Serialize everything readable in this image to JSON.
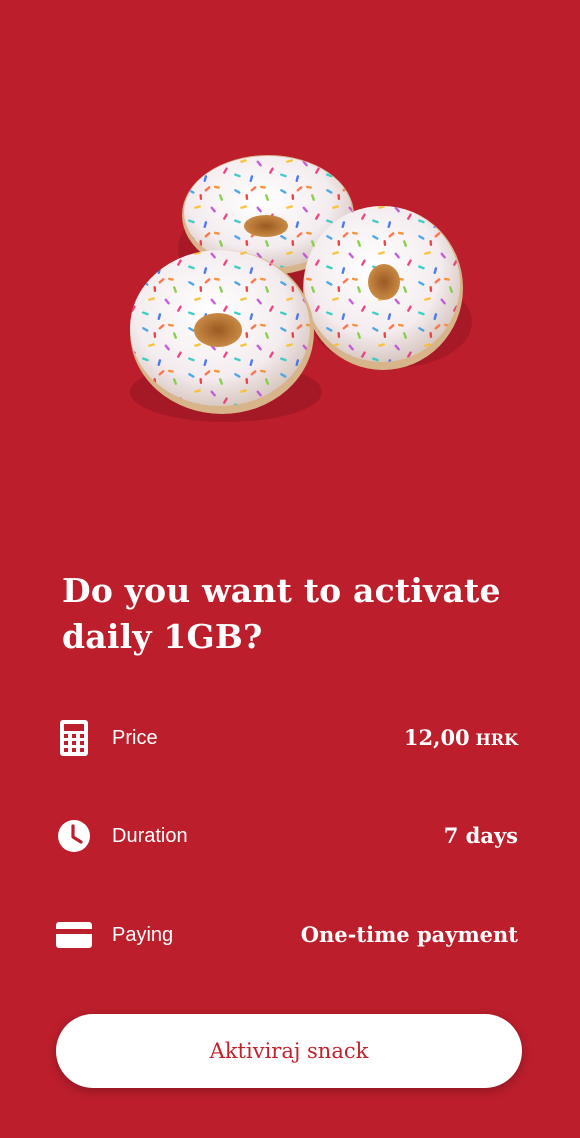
{
  "theme": {
    "background": "#bc1e2c",
    "button_text_color": "#c0222d"
  },
  "hero": {
    "image": "donuts-with-sprinkles"
  },
  "title": "Do you want to activate daily 1GB?",
  "details": [
    {
      "icon": "calculator-icon",
      "label": "Price",
      "value": "12,00",
      "unit": "HRK"
    },
    {
      "icon": "clock-icon",
      "label": "Duration",
      "value": "7 days"
    },
    {
      "icon": "credit-card-icon",
      "label": "Paying",
      "value": "One-time payment"
    }
  ],
  "cta": {
    "label": "Aktiviraj snack"
  }
}
